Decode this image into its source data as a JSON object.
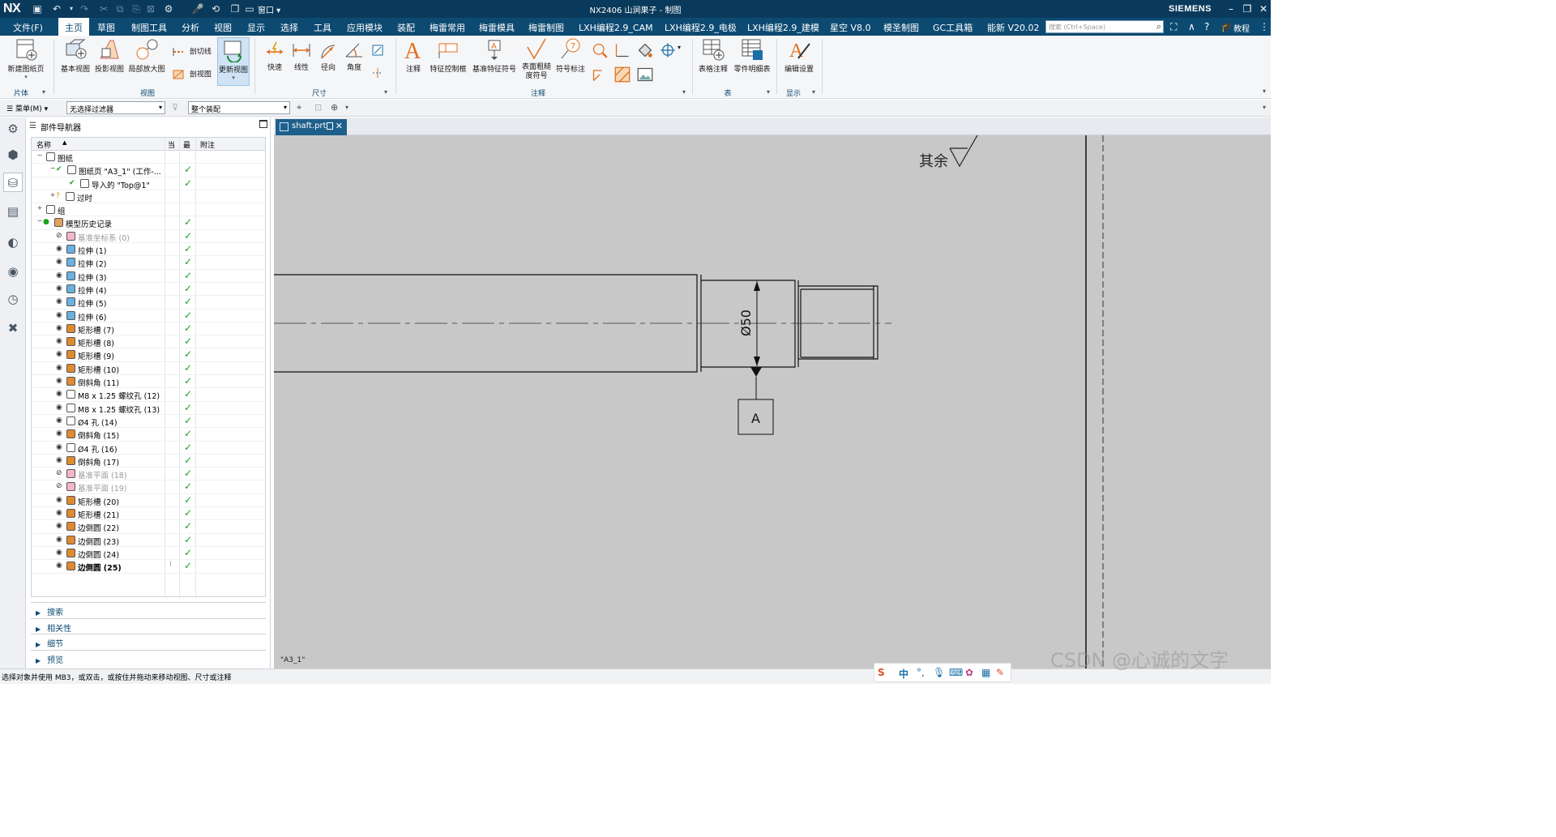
{
  "titlebar": {
    "logo": "NX",
    "window_menu": "窗口 ▾",
    "title": "NX2406 山涧果子 - 制图",
    "brand": "SIEMENS"
  },
  "menubar": {
    "items": [
      "文件(F)",
      "主页",
      "草图",
      "制图工具",
      "分析",
      "视图",
      "显示",
      "选择",
      "工具",
      "应用模块",
      "装配",
      "梅雷常用",
      "梅雷模具",
      "梅雷制图",
      "LXH编程2.9_CAM",
      "LXH编程2.9_电极",
      "LXH编程2.9_建模",
      "星空 V8.0",
      "模圣制图",
      "GC工具箱",
      "能新 V20.02"
    ],
    "active": "主页",
    "search_placeholder": "搜索 (Ctrl+Space)",
    "help_label": "教程"
  },
  "ribbon": {
    "new_sheet": "新建图纸页",
    "base_view": "基本视图",
    "projected_view": "投影视图",
    "detail_view": "局部放大图",
    "section_line": "剖切线",
    "section_view": "剖视图",
    "update_view": "更新视图",
    "rapid": "快速",
    "linear": "线性",
    "radial": "径向",
    "angular": "角度",
    "note": "注释",
    "feature_control_frame": "特征控制框",
    "datum_feature_symbol": "基准特征符号",
    "surface_finish": "表面粗糙度符号",
    "symbol_label": "符号标注",
    "table_note": "表格注释",
    "parts_list": "零件明细表",
    "edit_settings": "编辑设置",
    "groups": {
      "sheet": "片体",
      "view": "视图",
      "dimension": "尺寸",
      "annotation": "注释",
      "table": "表",
      "display": "显示"
    }
  },
  "selbar": {
    "menu_label": "菜单(M) ▾",
    "filter_value": "无选择过滤器",
    "scope_value": "整个装配"
  },
  "navigator": {
    "title": "部件导航器",
    "columns": {
      "name": "名称",
      "current": "当",
      "latest": "最",
      "notes": "附注"
    },
    "rows": [
      {
        "label": "图纸",
        "indent": 0,
        "exp": "-",
        "icon": "sheet",
        "check": false,
        "dim": false,
        "bold": false
      },
      {
        "label": "图纸页 \"A3_1\" (工作-...",
        "indent": 1,
        "exp": "-",
        "icon": "sheet",
        "check": true,
        "dim": false,
        "bold": false
      },
      {
        "label": "导入的 \"Top@1\"",
        "indent": 2,
        "exp": "",
        "icon": "view",
        "check": true,
        "dim": false,
        "bold": false
      },
      {
        "label": "过时",
        "indent": 1,
        "exp": "+",
        "icon": "folder",
        "check": false,
        "dim": false,
        "bold": false
      },
      {
        "label": "组",
        "indent": 0,
        "exp": "+",
        "icon": "group",
        "check": false,
        "dim": false,
        "bold": false
      },
      {
        "label": "模型历史记录",
        "indent": 0,
        "exp": "-",
        "icon": "history",
        "check": true,
        "dim": false,
        "bold": false
      },
      {
        "label": "基准坐标系 (0)",
        "indent": 1,
        "exp": "",
        "icon": "csys",
        "check": true,
        "dim": true,
        "bold": false
      },
      {
        "label": "拉伸 (1)",
        "indent": 1,
        "exp": "",
        "icon": "extrude",
        "check": true,
        "dim": false,
        "bold": false
      },
      {
        "label": "拉伸 (2)",
        "indent": 1,
        "exp": "",
        "icon": "extrude",
        "check": true,
        "dim": false,
        "bold": false
      },
      {
        "label": "拉伸 (3)",
        "indent": 1,
        "exp": "",
        "icon": "extrude",
        "check": true,
        "dim": false,
        "bold": false
      },
      {
        "label": "拉伸 (4)",
        "indent": 1,
        "exp": "",
        "icon": "extrude",
        "check": true,
        "dim": false,
        "bold": false
      },
      {
        "label": "拉伸 (5)",
        "indent": 1,
        "exp": "",
        "icon": "extrude",
        "check": true,
        "dim": false,
        "bold": false
      },
      {
        "label": "拉伸 (6)",
        "indent": 1,
        "exp": "",
        "icon": "extrude",
        "check": true,
        "dim": false,
        "bold": false
      },
      {
        "label": "矩形槽 (7)",
        "indent": 1,
        "exp": "",
        "icon": "groove",
        "check": true,
        "dim": false,
        "bold": false
      },
      {
        "label": "矩形槽 (8)",
        "indent": 1,
        "exp": "",
        "icon": "groove",
        "check": true,
        "dim": false,
        "bold": false
      },
      {
        "label": "矩形槽 (9)",
        "indent": 1,
        "exp": "",
        "icon": "groove",
        "check": true,
        "dim": false,
        "bold": false
      },
      {
        "label": "矩形槽 (10)",
        "indent": 1,
        "exp": "",
        "icon": "groove",
        "check": true,
        "dim": false,
        "bold": false
      },
      {
        "label": "倒斜角 (11)",
        "indent": 1,
        "exp": "",
        "icon": "chamfer",
        "check": true,
        "dim": false,
        "bold": false
      },
      {
        "label": "M8 x 1.25 螺纹孔 (12)",
        "indent": 1,
        "exp": "",
        "icon": "hole",
        "check": true,
        "dim": false,
        "bold": false
      },
      {
        "label": "M8 x 1.25 螺纹孔 (13)",
        "indent": 1,
        "exp": "",
        "icon": "hole",
        "check": true,
        "dim": false,
        "bold": false
      },
      {
        "label": "Ø4 孔 (14)",
        "indent": 1,
        "exp": "",
        "icon": "hole",
        "check": true,
        "dim": false,
        "bold": false
      },
      {
        "label": "倒斜角 (15)",
        "indent": 1,
        "exp": "",
        "icon": "chamfer",
        "check": true,
        "dim": false,
        "bold": false
      },
      {
        "label": "Ø4 孔 (16)",
        "indent": 1,
        "exp": "",
        "icon": "hole",
        "check": true,
        "dim": false,
        "bold": false
      },
      {
        "label": "倒斜角 (17)",
        "indent": 1,
        "exp": "",
        "icon": "chamfer",
        "check": true,
        "dim": false,
        "bold": false
      },
      {
        "label": "基准平面 (18)",
        "indent": 1,
        "exp": "",
        "icon": "plane",
        "check": true,
        "dim": true,
        "bold": false
      },
      {
        "label": "基准平面 (19)",
        "indent": 1,
        "exp": "",
        "icon": "plane",
        "check": true,
        "dim": true,
        "bold": false
      },
      {
        "label": "矩形槽 (20)",
        "indent": 1,
        "exp": "",
        "icon": "groove",
        "check": true,
        "dim": false,
        "bold": false
      },
      {
        "label": "矩形槽 (21)",
        "indent": 1,
        "exp": "",
        "icon": "groove",
        "check": true,
        "dim": false,
        "bold": false
      },
      {
        "label": "边倒圆 (22)",
        "indent": 1,
        "exp": "",
        "icon": "blend",
        "check": true,
        "dim": false,
        "bold": false
      },
      {
        "label": "边倒圆 (23)",
        "indent": 1,
        "exp": "",
        "icon": "blend",
        "check": true,
        "dim": false,
        "bold": false
      },
      {
        "label": "边倒圆 (24)",
        "indent": 1,
        "exp": "",
        "icon": "blend",
        "check": true,
        "dim": false,
        "bold": false
      },
      {
        "label": "边倒圆 (25)",
        "indent": 1,
        "exp": "",
        "icon": "blend",
        "check": true,
        "dim": false,
        "bold": true
      }
    ],
    "panels": [
      "搜索",
      "相关性",
      "细节",
      "预览"
    ]
  },
  "graphics": {
    "tab_label": "shaft.prt",
    "surface_note": "其余",
    "dimension_text": "Ø50",
    "datum_label": "A",
    "sheet_label": "\"A3_1\""
  },
  "statusbar": {
    "message": "选择对象并使用 MB3，或双击，或按住并拖动来移动视图、尺寸或注释",
    "ime_lang": "中"
  },
  "watermark": "CSDN @心诚的文字",
  "colors": {
    "titlebar_bg": "#0a3a5b",
    "menubar_bg": "#0d4a72",
    "canvas_bg": "#c8c8c8",
    "check_green": "#1aa31a"
  }
}
